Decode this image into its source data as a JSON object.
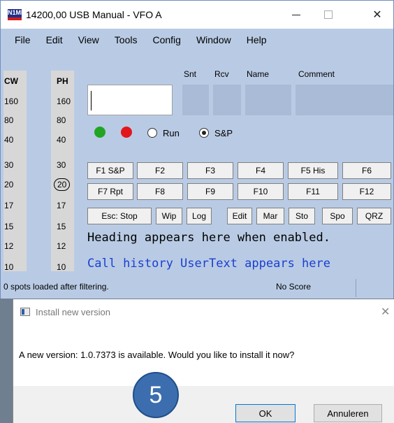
{
  "window": {
    "title": "14200,00 USB Manual - VFO A",
    "app_icon": "N1MM",
    "controls": {
      "minimize_icon": "minimize-icon",
      "maximize_icon": "maximize-icon",
      "close_icon": "close-icon",
      "close_glyph": "✕"
    }
  },
  "menu": [
    "File",
    "Edit",
    "View",
    "Tools",
    "Config",
    "Window",
    "Help"
  ],
  "bands": {
    "cw_header": "CW",
    "ph_header": "PH",
    "cw": [
      "160",
      "80",
      "40",
      "30",
      "20",
      "17",
      "15",
      "12",
      "10"
    ],
    "ph": [
      "160",
      "80",
      "40",
      "30",
      "20",
      "17",
      "15",
      "12",
      "10"
    ],
    "selected_ph": "20"
  },
  "fields": {
    "snt": "Snt",
    "rcv": "Rcv",
    "name": "Name",
    "comment": "Comment"
  },
  "mode": {
    "run_label": "Run",
    "sp_label": "S&P",
    "selected": "S&P"
  },
  "fkeys_row1": [
    "F1 S&P",
    "F2",
    "F3",
    "F4",
    "F5 His",
    "F6"
  ],
  "fkeys_row2": [
    "F7 Rpt",
    "F8",
    "F9",
    "F10",
    "F11",
    "F12"
  ],
  "buttons_row3": [
    "Esc: Stop",
    "Wip",
    "Log",
    "Edit",
    "Mar",
    "Sto",
    "Spo",
    "QRZ"
  ],
  "heading_text": "Heading appears here when enabled.",
  "call_history_text": "Call history UserText appears here",
  "status": {
    "spots": "0 spots loaded after filtering.",
    "score": "No Score"
  },
  "dialog": {
    "title": "Install new version",
    "close_glyph": "✕",
    "message": "A new version: 1.0.7373 is available. Would you like to install it now?",
    "ok_label": "OK",
    "cancel_label": "Annuleren"
  },
  "step_badge": "5",
  "colors": {
    "green_dot": "#22a522",
    "red_dot": "#e3161c",
    "blue_text": "#1a3fd0",
    "badge": "#3c6eaf"
  }
}
